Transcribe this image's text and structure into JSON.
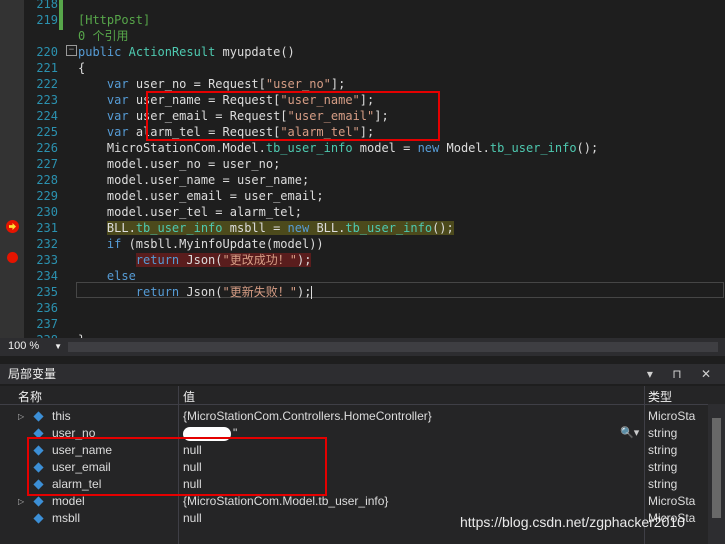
{
  "editor": {
    "lines": [
      {
        "no": "218",
        "html": ""
      },
      {
        "no": "219",
        "html": "<span class=\"cm\">[HttpPost]</span>"
      },
      {
        "no": "",
        "html": "<span class=\"cm\">0 个引用</span>"
      },
      {
        "no": "220",
        "html": "<span class=\"kw\">public</span> <span class=\"cls\">ActionResult</span> myupdate()"
      },
      {
        "no": "221",
        "html": "{"
      },
      {
        "no": "222",
        "html": "    <span class=\"kw\">var</span> user_no = Request[<span class=\"str\">\"user_no\"</span>];"
      },
      {
        "no": "223",
        "html": "    <span class=\"kw\">var</span> user_name = Request[<span class=\"str\">\"user_name\"</span>];"
      },
      {
        "no": "224",
        "html": "    <span class=\"kw\">var</span> user_email = Request[<span class=\"str\">\"user_email\"</span>];"
      },
      {
        "no": "225",
        "html": "    <span class=\"kw\">var</span> alarm_tel = Request[<span class=\"str\">\"alarm_tel\"</span>];"
      },
      {
        "no": "226",
        "html": "    MicroStationCom.Model.<span class=\"cls\">tb_user_info</span> model = <span class=\"kw\">new</span> Model.<span class=\"cls\">tb_user_info</span>();"
      },
      {
        "no": "227",
        "html": "    model.user_no = user_no;"
      },
      {
        "no": "228",
        "html": "    model.user_name = user_name;"
      },
      {
        "no": "229",
        "html": "    model.user_email = user_email;"
      },
      {
        "no": "230",
        "html": "    model.user_tel = alarm_tel;"
      },
      {
        "no": "231",
        "html": "    <span class=\"hl-yellow\">BLL.<span class=\"cls\">tb_user_info</span> msbll = <span class=\"kw\">new</span> BLL.<span class=\"cls\">tb_user_info</span>();</span>"
      },
      {
        "no": "232",
        "html": "    <span class=\"kw\">if</span> (msbll.MyinfoUpdate(model))"
      },
      {
        "no": "233",
        "html": "        <span class=\"hl-red\"><span class=\"kw\">return</span> Json(<span class=\"str\">\"更改成功！\"</span>);</span>"
      },
      {
        "no": "234",
        "html": "    <span class=\"kw\">else</span>"
      },
      {
        "no": "235",
        "html": "        <span class=\"kw\">return</span> Json(<span class=\"str\">\"更新失败！\"</span>);<span class=\"caret\"></span>"
      },
      {
        "no": "236",
        "html": ""
      },
      {
        "no": "237",
        "html": ""
      },
      {
        "no": "238",
        "html": "}"
      }
    ]
  },
  "zoom": {
    "value": "100 %"
  },
  "locals_panel": {
    "title": "局部变量",
    "controls": "▾ ⊓ ✕",
    "headers": {
      "name": "名称",
      "value": "值",
      "type": "类型"
    },
    "rows": [
      {
        "name": "this",
        "value": "{MicroStationCom.Controllers.HomeController}",
        "type": "MicroSta",
        "expandable": true
      },
      {
        "name": "user_no",
        "value": "\"",
        "type": "string",
        "expandable": false
      },
      {
        "name": "user_name",
        "value": "null",
        "type": "string",
        "expandable": false
      },
      {
        "name": "user_email",
        "value": "null",
        "type": "string",
        "expandable": false
      },
      {
        "name": "alarm_tel",
        "value": "null",
        "type": "string",
        "expandable": false
      },
      {
        "name": "model",
        "value": "{MicroStationCom.Model.tb_user_info}",
        "type": "MicroSta",
        "expandable": true
      },
      {
        "name": "msbll",
        "value": "null",
        "type": "MicroSta",
        "expandable": false
      }
    ]
  },
  "watermark": "https://blog.csdn.net/zgphacker2010"
}
